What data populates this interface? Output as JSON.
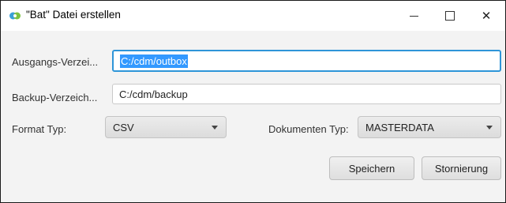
{
  "window": {
    "title": "\"Bat\" Datei erstellen"
  },
  "controls": {
    "minimize_icon": "minimize-icon",
    "maximize_icon": "maximize-icon",
    "close_icon": "close-icon",
    "close_glyph": "✕"
  },
  "form": {
    "output_dir": {
      "label": "Ausgangs-Verzei...",
      "value": "C:/cdm/outbox"
    },
    "backup_dir": {
      "label": "Backup-Verzeich...",
      "value": "C:/cdm/backup"
    },
    "format_type": {
      "label": "Format Typ:",
      "value": "CSV"
    },
    "document_type": {
      "label": "Dokumenten Typ:",
      "value": "MASTERDATA"
    }
  },
  "buttons": {
    "save": "Speichern",
    "cancel": "Stornierung"
  }
}
